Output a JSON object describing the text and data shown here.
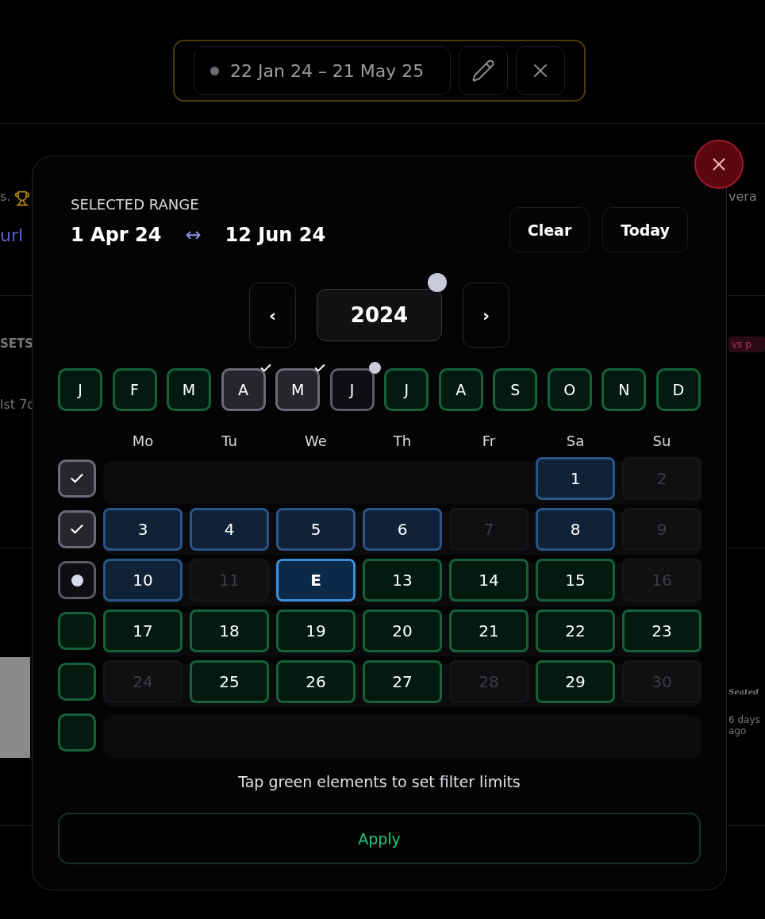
{
  "backdrop": {
    "left_texts": [
      {
        "kind": "plain",
        "text": "s."
      },
      {
        "kind": "link",
        "text": "url"
      },
      {
        "kind": "heading",
        "text": "SETS"
      },
      {
        "kind": "plain",
        "text": "lst 7d"
      }
    ],
    "right_texts": [
      {
        "kind": "plain",
        "text": "vera"
      },
      {
        "kind": "badge",
        "text": "vs p"
      },
      {
        "kind": "title",
        "text": "Seated"
      },
      {
        "kind": "plain",
        "text": "6 days ago"
      }
    ]
  },
  "filter_bar": {
    "range": "22 Jan 24 – 21 May 25"
  },
  "picker": {
    "label": "SELECTED RANGE",
    "start": "1 Apr 24",
    "arrow": "↔",
    "end": "12 Jun 24",
    "actions": [
      "Clear",
      "Today"
    ],
    "year": {
      "prev": "‹",
      "value": "2024",
      "next": "›",
      "partial": true
    },
    "months": [
      {
        "label": "J",
        "checked": false,
        "partial": false
      },
      {
        "label": "F",
        "checked": false,
        "partial": false
      },
      {
        "label": "M",
        "checked": false,
        "partial": false
      },
      {
        "label": "A",
        "checked": true,
        "partial": false
      },
      {
        "label": "M",
        "checked": true,
        "partial": false
      },
      {
        "label": "J",
        "checked": false,
        "partial": true
      },
      {
        "label": "J",
        "checked": false,
        "partial": false
      },
      {
        "label": "A",
        "checked": false,
        "partial": false
      },
      {
        "label": "S",
        "checked": false,
        "partial": false
      },
      {
        "label": "O",
        "checked": false,
        "partial": false
      },
      {
        "label": "N",
        "checked": false,
        "partial": false
      },
      {
        "label": "D",
        "checked": false,
        "partial": false
      }
    ],
    "weekdays": [
      "Mo",
      "Tu",
      "We",
      "Th",
      "Fr",
      "Sa",
      "Su"
    ],
    "weeks": [
      {
        "checked": true,
        "partial": false,
        "days": [
          {
            "kind": "blank"
          },
          {
            "kind": "blank"
          },
          {
            "kind": "blank"
          },
          {
            "kind": "blank"
          },
          {
            "kind": "blank"
          },
          {
            "kind": "range",
            "label": "1"
          },
          {
            "kind": "unavailable",
            "label": "2"
          }
        ]
      },
      {
        "checked": true,
        "partial": false,
        "days": [
          {
            "kind": "range",
            "label": "3"
          },
          {
            "kind": "range",
            "label": "4"
          },
          {
            "kind": "range",
            "label": "5"
          },
          {
            "kind": "range",
            "label": "6"
          },
          {
            "kind": "unavailable",
            "label": "7"
          },
          {
            "kind": "range",
            "label": "8"
          },
          {
            "kind": "unavailable",
            "label": "9"
          }
        ]
      },
      {
        "checked": false,
        "partial": true,
        "days": [
          {
            "kind": "range",
            "label": "10"
          },
          {
            "kind": "unavailable",
            "label": "11"
          },
          {
            "kind": "end",
            "label": "E"
          },
          {
            "kind": "available",
            "label": "13"
          },
          {
            "kind": "available",
            "label": "14"
          },
          {
            "kind": "available",
            "label": "15"
          },
          {
            "kind": "unavailable",
            "label": "16"
          }
        ]
      },
      {
        "checked": false,
        "partial": false,
        "days": [
          {
            "kind": "available",
            "label": "17"
          },
          {
            "kind": "available",
            "label": "18"
          },
          {
            "kind": "available",
            "label": "19"
          },
          {
            "kind": "available",
            "label": "20"
          },
          {
            "kind": "available",
            "label": "21"
          },
          {
            "kind": "available",
            "label": "22"
          },
          {
            "kind": "available",
            "label": "23"
          }
        ]
      },
      {
        "checked": false,
        "partial": false,
        "days": [
          {
            "kind": "unavailable",
            "label": "24"
          },
          {
            "kind": "available",
            "label": "25"
          },
          {
            "kind": "available",
            "label": "26"
          },
          {
            "kind": "available",
            "label": "27"
          },
          {
            "kind": "unavailable",
            "label": "28"
          },
          {
            "kind": "available",
            "label": "29"
          },
          {
            "kind": "unavailable",
            "label": "30"
          }
        ]
      },
      {
        "checked": false,
        "partial": false,
        "days": [
          {
            "kind": "blank"
          },
          {
            "kind": "blank"
          },
          {
            "kind": "blank"
          },
          {
            "kind": "blank"
          },
          {
            "kind": "blank"
          },
          {
            "kind": "blank"
          },
          {
            "kind": "blank"
          }
        ]
      }
    ],
    "hint": "Tap green elements to set filter limits",
    "apply": "Apply"
  }
}
